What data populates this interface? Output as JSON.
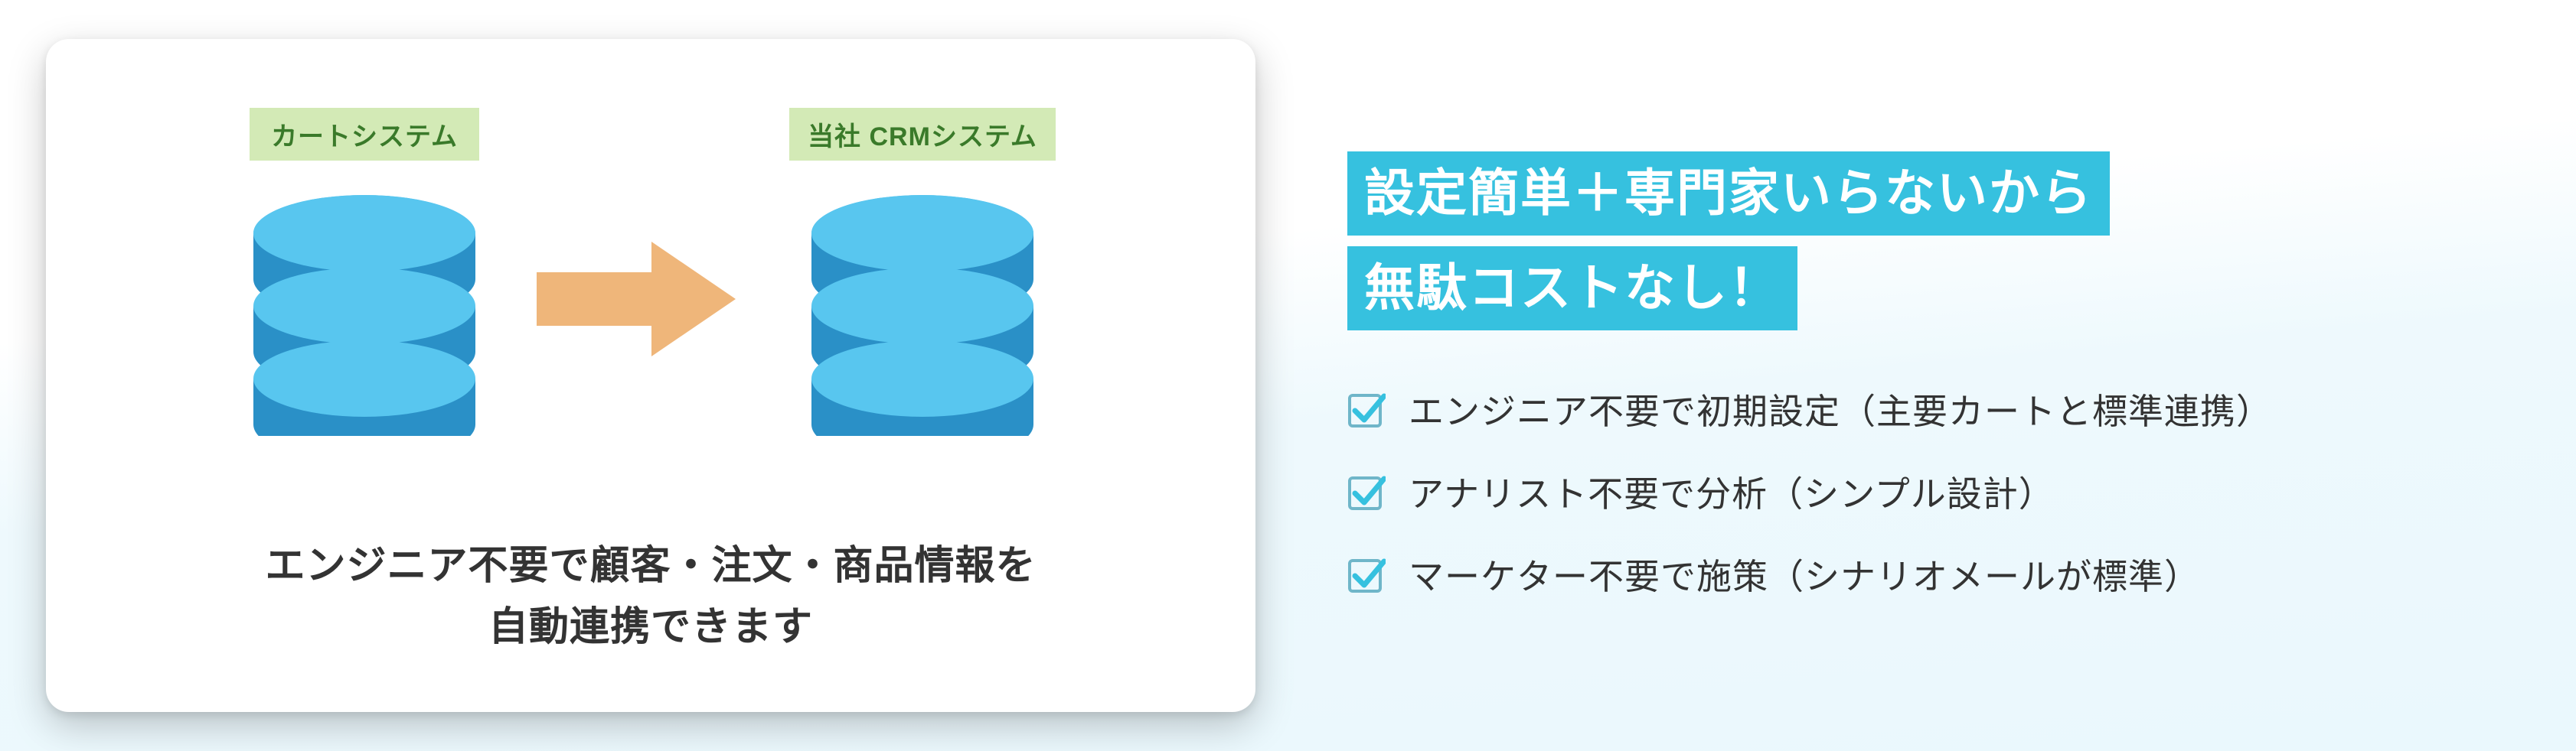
{
  "diagram": {
    "left_label": "カートシステム",
    "right_label": "当社 CRMシステム",
    "caption_line1": "エンジニア不要で顧客・注文・商品情報を",
    "caption_line2": "自動連携できます"
  },
  "headline": {
    "line1": "設定簡単＋専門家いらないから",
    "line2": "無駄コストなし！"
  },
  "bullets": [
    "エンジニア不要で初期設定（主要カートと標準連携）",
    "アナリスト不要で分析（シンプル設計）",
    "マーケター不要で施策（シナリオメールが標準）"
  ],
  "colors": {
    "accent": "#36c1df",
    "db_top": "#58c6ef",
    "db_side": "#2a90c7",
    "db_edge": "#1f6fa0",
    "arrow": "#efb67a",
    "tag_bg": "#d3eab6",
    "tag_text": "#3a7a2a"
  }
}
